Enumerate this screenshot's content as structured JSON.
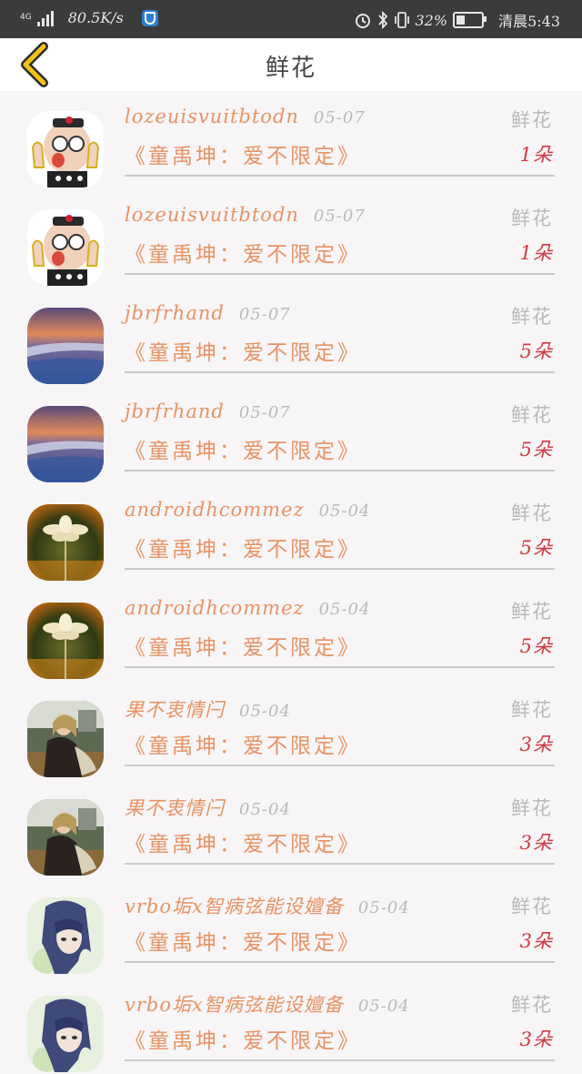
{
  "status_bar": {
    "network": "4G",
    "speed": "80.5K/s",
    "battery": "32%",
    "time": "清晨5:43",
    "icons": [
      "signal-icon",
      "shield-app-icon",
      "alarm-icon",
      "bluetooth-icon",
      "vibrate-icon",
      "battery-icon"
    ]
  },
  "header": {
    "title": "鲜花",
    "back_icon": "chevron-left-icon",
    "accent_color": "#f2c21b"
  },
  "colors": {
    "name": "#e79364",
    "date": "#b9b9b9",
    "count": "#d03a47"
  },
  "items": [
    {
      "name": "lozeuisvuitbtodn",
      "date": "05-07",
      "song": "《童禹坤：爱不限定》",
      "gift": "鲜花",
      "count": "1朵",
      "avatar": "cartoon"
    },
    {
      "name": "lozeuisvuitbtodn",
      "date": "05-07",
      "song": "《童禹坤：爱不限定》",
      "gift": "鲜花",
      "count": "1朵",
      "avatar": "cartoon"
    },
    {
      "name": "jbrfrhand",
      "date": "05-07",
      "song": "《童禹坤：爱不限定》",
      "gift": "鲜花",
      "count": "5朵",
      "avatar": "sea"
    },
    {
      "name": "jbrfrhand",
      "date": "05-07",
      "song": "《童禹坤：爱不限定》",
      "gift": "鲜花",
      "count": "5朵",
      "avatar": "sea"
    },
    {
      "name": "androidhcommez",
      "date": "05-04",
      "song": "《童禹坤：爱不限定》",
      "gift": "鲜花",
      "count": "5朵",
      "avatar": "flower"
    },
    {
      "name": "androidhcommez",
      "date": "05-04",
      "song": "《童禹坤：爱不限定》",
      "gift": "鲜花",
      "count": "5朵",
      "avatar": "flower"
    },
    {
      "name": "果不衷情闩",
      "date": "05-04",
      "song": "《童禹坤：爱不限定》",
      "gift": "鲜花",
      "count": "3朵",
      "avatar": "girl"
    },
    {
      "name": "果不衷情闩",
      "date": "05-04",
      "song": "《童禹坤：爱不限定》",
      "gift": "鲜花",
      "count": "3朵",
      "avatar": "girl"
    },
    {
      "name": "vrbo垢x智病弦能设嬗备",
      "date": "05-04",
      "song": "《童禹坤：爱不限定》",
      "gift": "鲜花",
      "count": "3朵",
      "avatar": "anime"
    },
    {
      "name": "vrbo垢x智病弦能设嬗备",
      "date": "05-04",
      "song": "《童禹坤：爱不限定》",
      "gift": "鲜花",
      "count": "3朵",
      "avatar": "anime"
    }
  ]
}
